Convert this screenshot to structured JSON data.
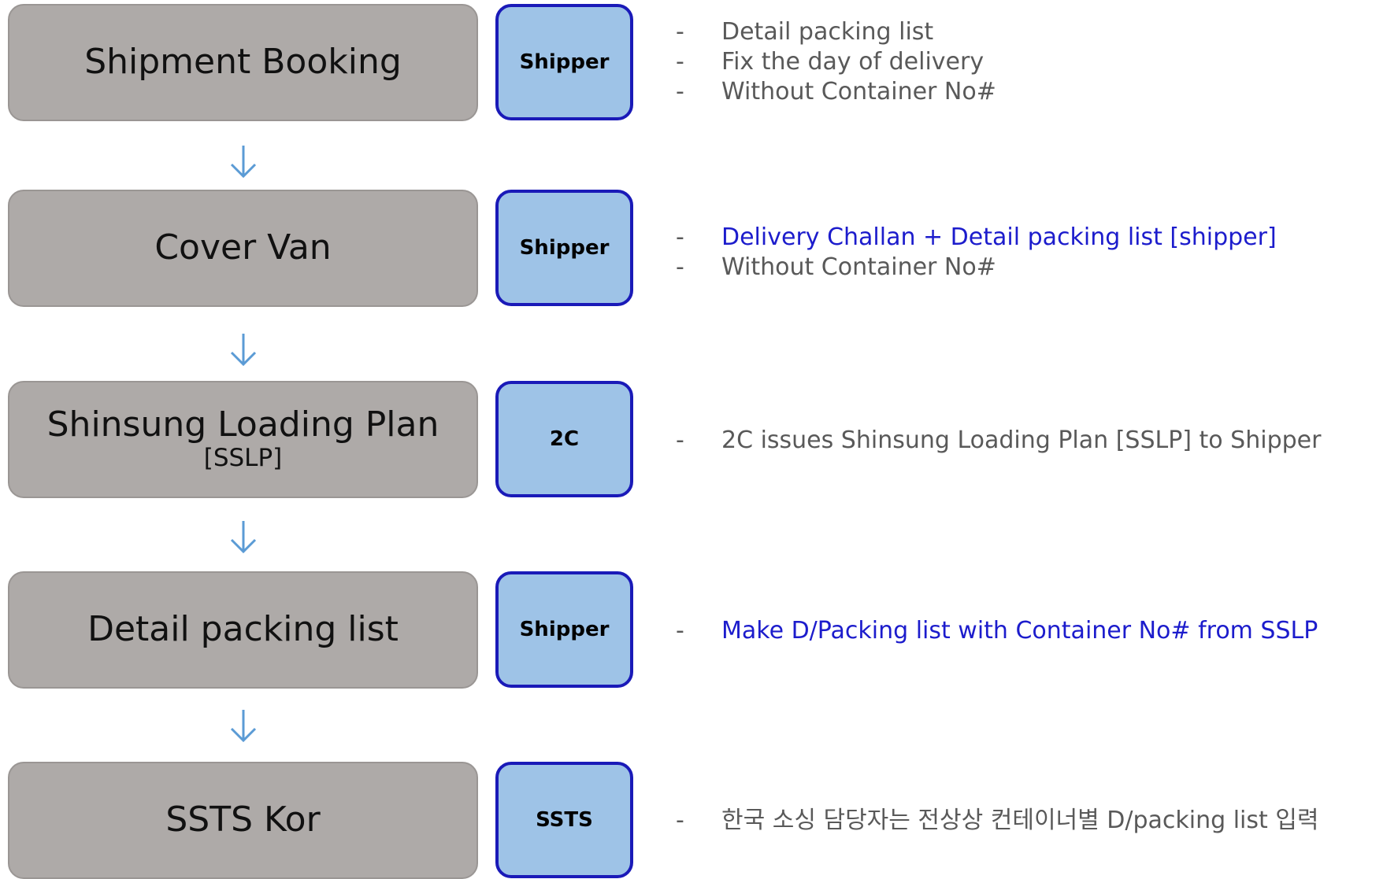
{
  "steps": [
    {
      "title": "Shipment Booking",
      "subtitle": "",
      "role": "Shipper",
      "notes": [
        {
          "text": "Detail packing list",
          "highlight": false
        },
        {
          "text": "Fix the day of delivery",
          "highlight": false
        },
        {
          "text": "Without Container No#",
          "highlight": false
        }
      ]
    },
    {
      "title": "Cover Van",
      "subtitle": "",
      "role": "Shipper",
      "notes": [
        {
          "text": "Delivery Challan + Detail packing list [shipper]",
          "highlight": true
        },
        {
          "text": "Without Container No#",
          "highlight": false
        }
      ]
    },
    {
      "title": "Shinsung Loading Plan",
      "subtitle": "[SSLP]",
      "role": "2C",
      "notes": [
        {
          "text": "2C issues Shinsung Loading Plan [SSLP] to Shipper",
          "highlight": false
        }
      ]
    },
    {
      "title": "Detail packing list",
      "subtitle": "",
      "role": "Shipper",
      "notes": [
        {
          "text": "Make D/Packing list with Container No# from SSLP",
          "highlight": true
        }
      ]
    },
    {
      "title": "SSTS Kor",
      "subtitle": "",
      "role": "SSTS",
      "notes": [
        {
          "text": "한국 소싱 담당자는 전상상 컨테이너별 D/packing list 입력",
          "highlight": false
        }
      ]
    }
  ],
  "colors": {
    "step_fill": "#aeaaa8",
    "role_fill": "#9ec3e7",
    "role_border": "#1a1ab8",
    "arrow": "#5b9bd5",
    "note_text": "#595959",
    "note_highlight": "#1c1ccc"
  },
  "icons": {
    "connector": "arrow-down-icon"
  }
}
